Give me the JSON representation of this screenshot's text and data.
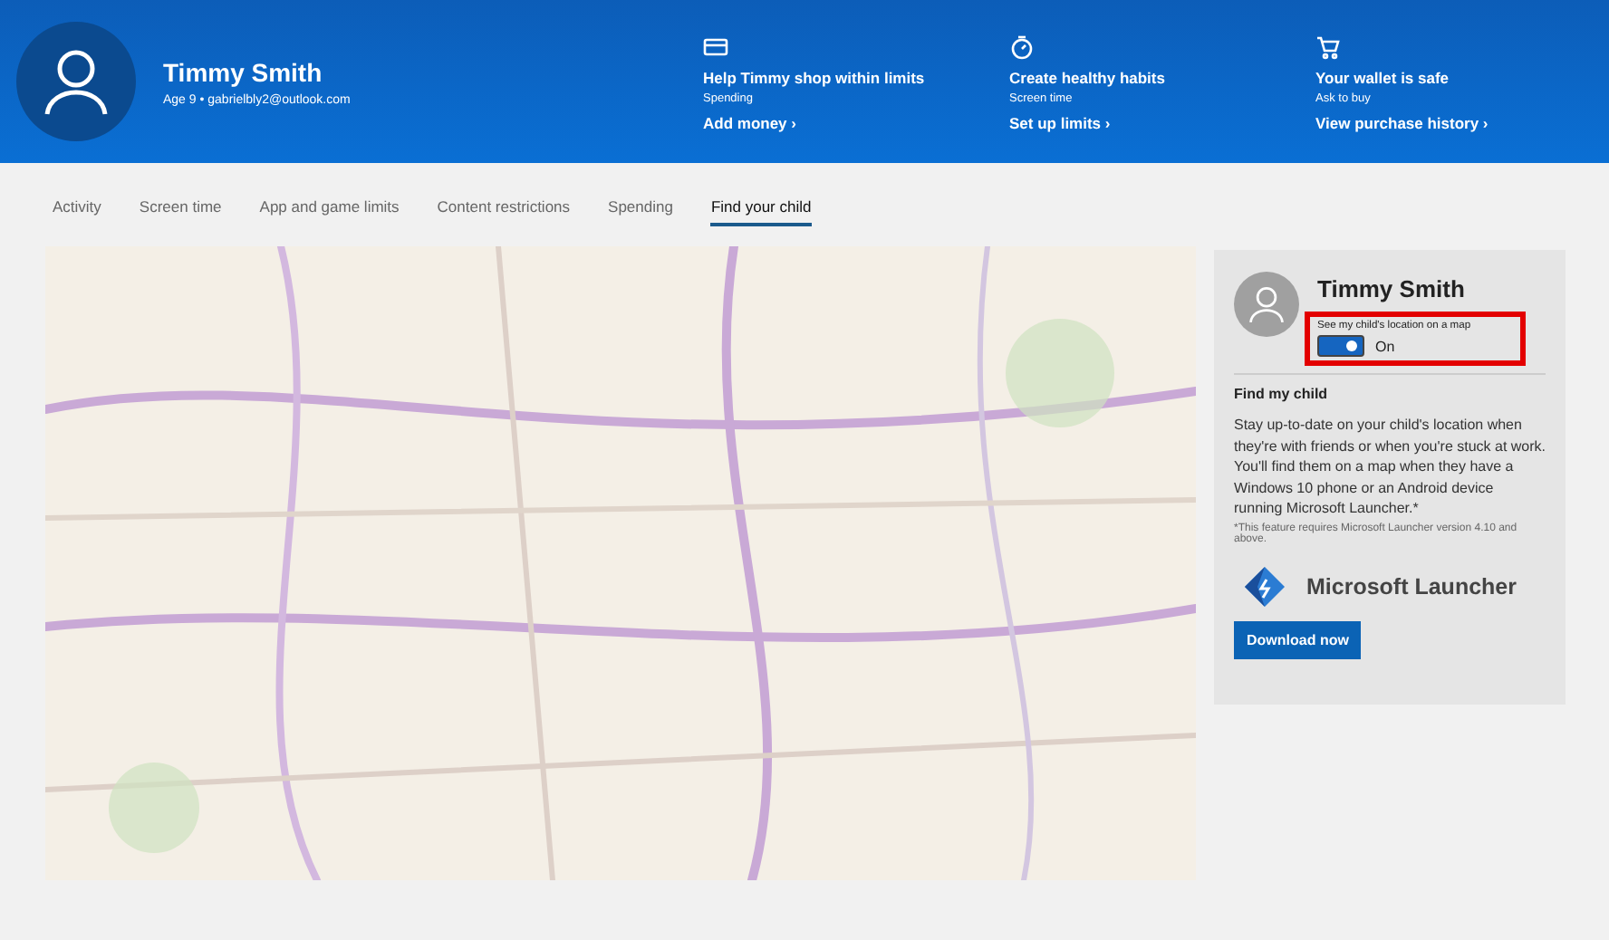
{
  "header": {
    "name": "Timmy Smith",
    "details": "Age 9 • gabrielbly2@outlook.com",
    "features": [
      {
        "kind": "card",
        "title": "Help Timmy shop within limits",
        "subtitle": "Spending",
        "link": "Add money ›"
      },
      {
        "kind": "timer",
        "title": "Create healthy habits",
        "subtitle": "Screen time",
        "link": "Set up limits ›"
      },
      {
        "kind": "cart",
        "title": "Your wallet is safe",
        "subtitle": "Ask to buy",
        "link": "View purchase history ›"
      }
    ]
  },
  "tabs": [
    {
      "label": "Activity",
      "selected": false
    },
    {
      "label": "Screen time",
      "selected": false
    },
    {
      "label": "App and game limits",
      "selected": false
    },
    {
      "label": "Content restrictions",
      "selected": false
    },
    {
      "label": "Spending",
      "selected": false
    },
    {
      "label": "Find your child",
      "selected": true
    }
  ],
  "panel": {
    "name": "Timmy Smith",
    "toggle_label": "See my child's location on a map",
    "toggle": {
      "on": true,
      "text": "On"
    },
    "heading": "Find my child",
    "description": "Stay up-to-date on your child's location when they're with friends or when you're stuck at work. You'll find them on a map when they have a Windows 10 phone or an Android device running Microsoft Launcher.*",
    "footnote": "*This feature requires Microsoft Launcher version 4.10 and above.",
    "app_name": "Microsoft Launcher",
    "button": "Download now"
  }
}
